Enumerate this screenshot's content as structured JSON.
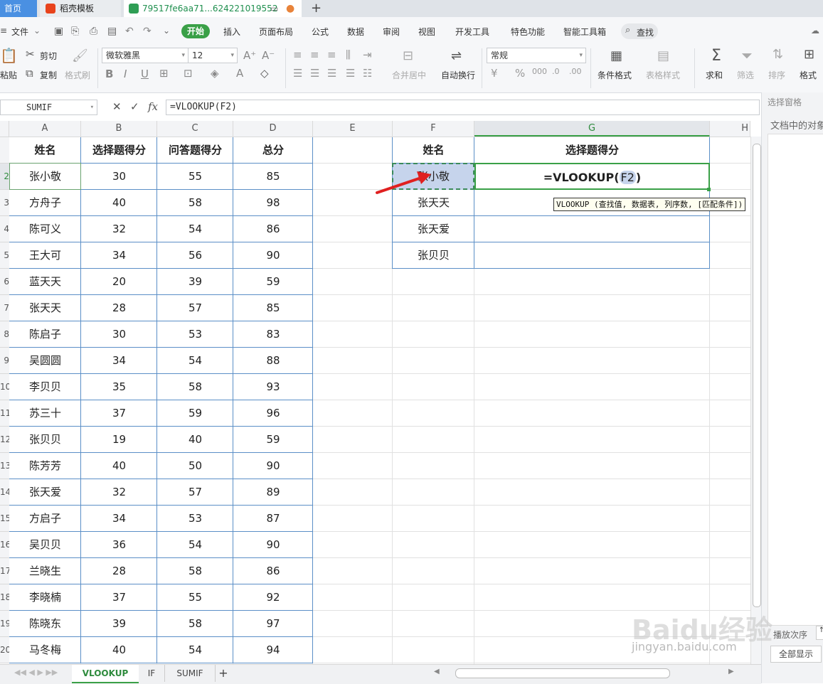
{
  "tabs": {
    "home": "首页",
    "template": "稻壳模板",
    "file": "79517fe6aa71...624221019552"
  },
  "menu": {
    "file": "文件",
    "start": "开始",
    "items": [
      "插入",
      "页面布局",
      "公式",
      "数据",
      "审阅",
      "视图",
      "开发工具",
      "特色功能",
      "智能工具箱"
    ],
    "search": "查找"
  },
  "ribbon": {
    "cut": "剪切",
    "paste": "粘贴",
    "copy": "复制",
    "format_painter": "格式刷",
    "font_name": "微软雅黑",
    "font_size": "12",
    "merge_center": "合并居中",
    "wrap_text": "自动换行",
    "number_format": "常规",
    "conditional_format": "条件格式",
    "table_style": "表格样式",
    "sum": "求和",
    "filter": "筛选",
    "sort": "排序",
    "format": "格式"
  },
  "formula_bar": {
    "name_box": "SUMIF",
    "cancel": "✕",
    "confirm": "✓",
    "fx": "fx",
    "formula": "=VLOOKUP(F2)"
  },
  "columns": [
    "A",
    "B",
    "C",
    "D",
    "E",
    "F",
    "G",
    "H"
  ],
  "table_main": {
    "headers": [
      "姓名",
      "选择题得分",
      "问答题得分",
      "总分"
    ],
    "rows": [
      [
        "张小敬",
        "30",
        "55",
        "85"
      ],
      [
        "方舟子",
        "40",
        "58",
        "98"
      ],
      [
        "陈可义",
        "32",
        "54",
        "86"
      ],
      [
        "王大可",
        "34",
        "56",
        "90"
      ],
      [
        "蓝天天",
        "20",
        "39",
        "59"
      ],
      [
        "张天天",
        "28",
        "57",
        "85"
      ],
      [
        "陈启子",
        "30",
        "53",
        "83"
      ],
      [
        "吴圆圆",
        "34",
        "54",
        "88"
      ],
      [
        "李贝贝",
        "35",
        "58",
        "93"
      ],
      [
        "苏三十",
        "37",
        "59",
        "96"
      ],
      [
        "张贝贝",
        "19",
        "40",
        "59"
      ],
      [
        "陈芳芳",
        "40",
        "50",
        "90"
      ],
      [
        "张天爱",
        "32",
        "57",
        "89"
      ],
      [
        "方启子",
        "34",
        "53",
        "87"
      ],
      [
        "吴贝贝",
        "36",
        "54",
        "90"
      ],
      [
        "兰晓生",
        "28",
        "58",
        "86"
      ],
      [
        "李晓楠",
        "37",
        "55",
        "92"
      ],
      [
        "陈晓东",
        "39",
        "58",
        "97"
      ],
      [
        "马冬梅",
        "40",
        "54",
        "94"
      ]
    ]
  },
  "row_numbers": [
    "",
    "2",
    "3",
    "4",
    "5",
    "6",
    "7",
    "8",
    "9",
    "10",
    "11",
    "12",
    "13",
    "14",
    "15",
    "16",
    "17",
    "18",
    "19",
    "20"
  ],
  "table_lookup": {
    "headers": [
      "姓名",
      "选择题得分"
    ],
    "names": [
      "张小敬",
      "张天天",
      "张天爱",
      "张贝贝"
    ],
    "active_formula": "=VLOOKUP(F2)",
    "formula_prefix": "=VLOOKUP(",
    "formula_ref": "F2",
    "formula_suffix": ")"
  },
  "tooltip": "VLOOKUP (查找值, 数据表, 列序数, [匹配条件])",
  "right_pane": {
    "title": "选择窗格",
    "objects": "文档中的对象",
    "order": "播放次序",
    "show_all": "全部显示"
  },
  "sheet_tabs": [
    "VLOOKUP",
    "IF",
    "SUMIF"
  ],
  "watermark": "Baidu经验",
  "watermark_url": "jingyan.baidu.com"
}
